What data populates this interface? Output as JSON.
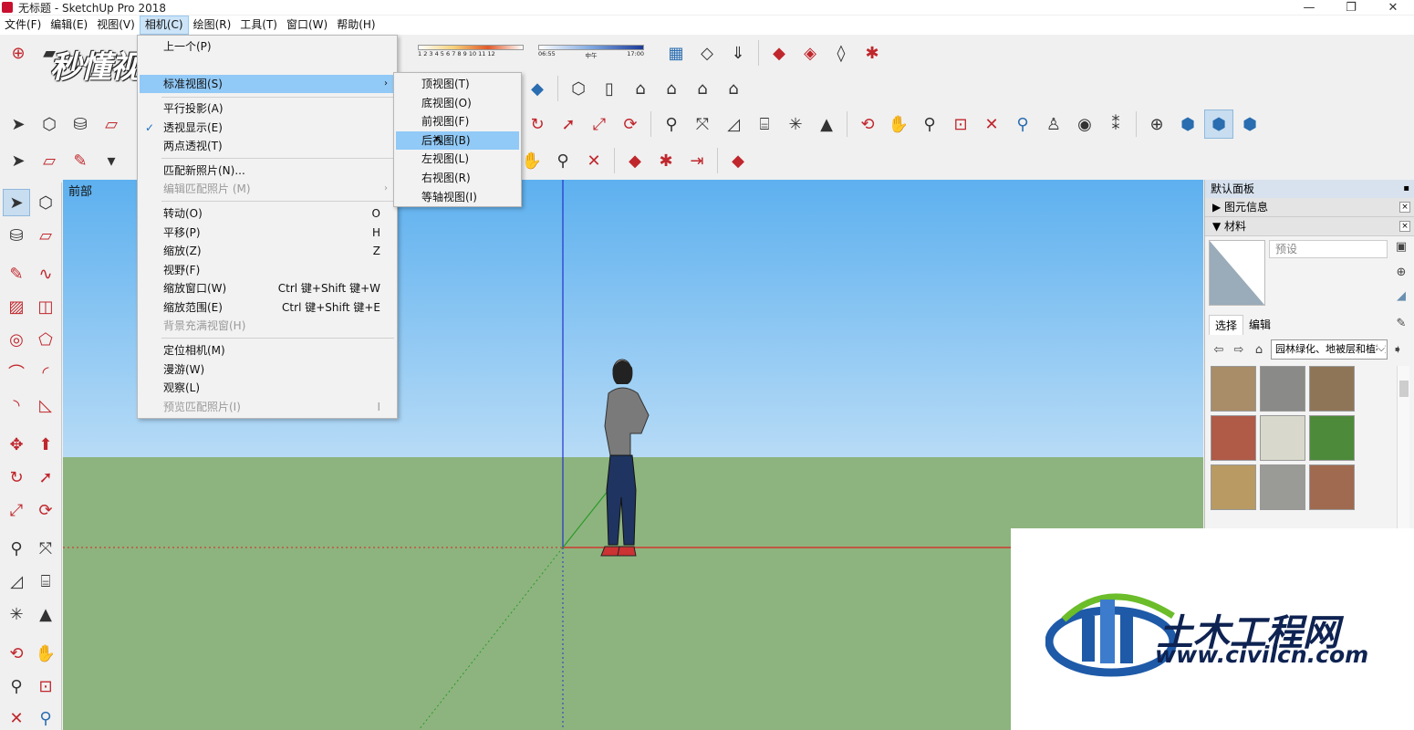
{
  "window": {
    "title": "无标题 - SketchUp Pro 2018",
    "minimize": "—",
    "maximize": "❐",
    "close": "✕"
  },
  "menubar": [
    "文件(F)",
    "编辑(E)",
    "视图(V)",
    "相机(C)",
    "绘图(R)",
    "工具(T)",
    "窗口(W)",
    "帮助(H)"
  ],
  "camera_menu": {
    "items": [
      {
        "label": "上一个(P)",
        "shortcut": "",
        "disabled": false
      },
      {
        "label": "标准视图(S)",
        "shortcut": "",
        "submenu": true,
        "highlighted": true
      },
      {
        "label": "平行投影(A)",
        "shortcut": ""
      },
      {
        "label": "透视显示(E)",
        "shortcut": "",
        "checked": true
      },
      {
        "label": "两点透视(T)",
        "shortcut": ""
      },
      {
        "label": "匹配新照片(N)...",
        "shortcut": ""
      },
      {
        "label": "编辑匹配照片 (M)",
        "shortcut": "",
        "disabled": true,
        "submenu": true
      },
      {
        "label": "转动(O)",
        "shortcut": "O"
      },
      {
        "label": "平移(P)",
        "shortcut": "H"
      },
      {
        "label": "缩放(Z)",
        "shortcut": "Z"
      },
      {
        "label": "视野(F)",
        "shortcut": ""
      },
      {
        "label": "缩放窗口(W)",
        "shortcut": "Ctrl 键+Shift 键+W"
      },
      {
        "label": "缩放范围(E)",
        "shortcut": "Ctrl 键+Shift 键+E"
      },
      {
        "label": "背景充满视窗(H)",
        "shortcut": "",
        "disabled": true
      },
      {
        "label": "定位相机(M)",
        "shortcut": ""
      },
      {
        "label": "漫游(W)",
        "shortcut": ""
      },
      {
        "label": "观察(L)",
        "shortcut": ""
      },
      {
        "label": "预览匹配照片(I)",
        "shortcut": "I",
        "disabled": true
      }
    ]
  },
  "standard_views_submenu": {
    "items": [
      "顶视图(T)",
      "底视图(O)",
      "前视图(F)",
      "后视图(B)",
      "左视图(L)",
      "右视图(R)",
      "等轴视图(I)"
    ],
    "highlighted": "后视图(B)"
  },
  "toolbar": {
    "shadow_months": "1 2 3 4 5 6 7 8 9 10 11 12",
    "shadow_time_start": "06:55",
    "shadow_time_mid": "中午",
    "shadow_time_end": "17:00"
  },
  "viewport": {
    "scene_label": "前部"
  },
  "tray": {
    "title": "默认面板",
    "pin": "▪",
    "sections": [
      {
        "label": "▶ 图元信息",
        "close": "×"
      },
      {
        "label": "▼ 材料",
        "close": "×"
      }
    ],
    "material_name_placeholder": "预设",
    "tabs": [
      "选择",
      "编辑"
    ],
    "collection": "园林绿化、地被层和植被",
    "swatch_colors": [
      "#a88d68",
      "#8a8a88",
      "#8f7558",
      "#b05a48",
      "#d8d8cc",
      "#4d8a3a",
      "#b89a62",
      "#9a9a96",
      "#a06a50"
    ]
  },
  "watermarks": {
    "top_left": "秒懂视频",
    "cn": "土木工程网",
    "url": "www.civilcn.com"
  },
  "colors": {
    "sky_top": "#5db0ef",
    "ground": "#8db47e",
    "menu_highlight": "#91c9f7",
    "axis_red": "#d22",
    "axis_green": "#2a9a2a",
    "axis_blue": "#2233cc"
  }
}
